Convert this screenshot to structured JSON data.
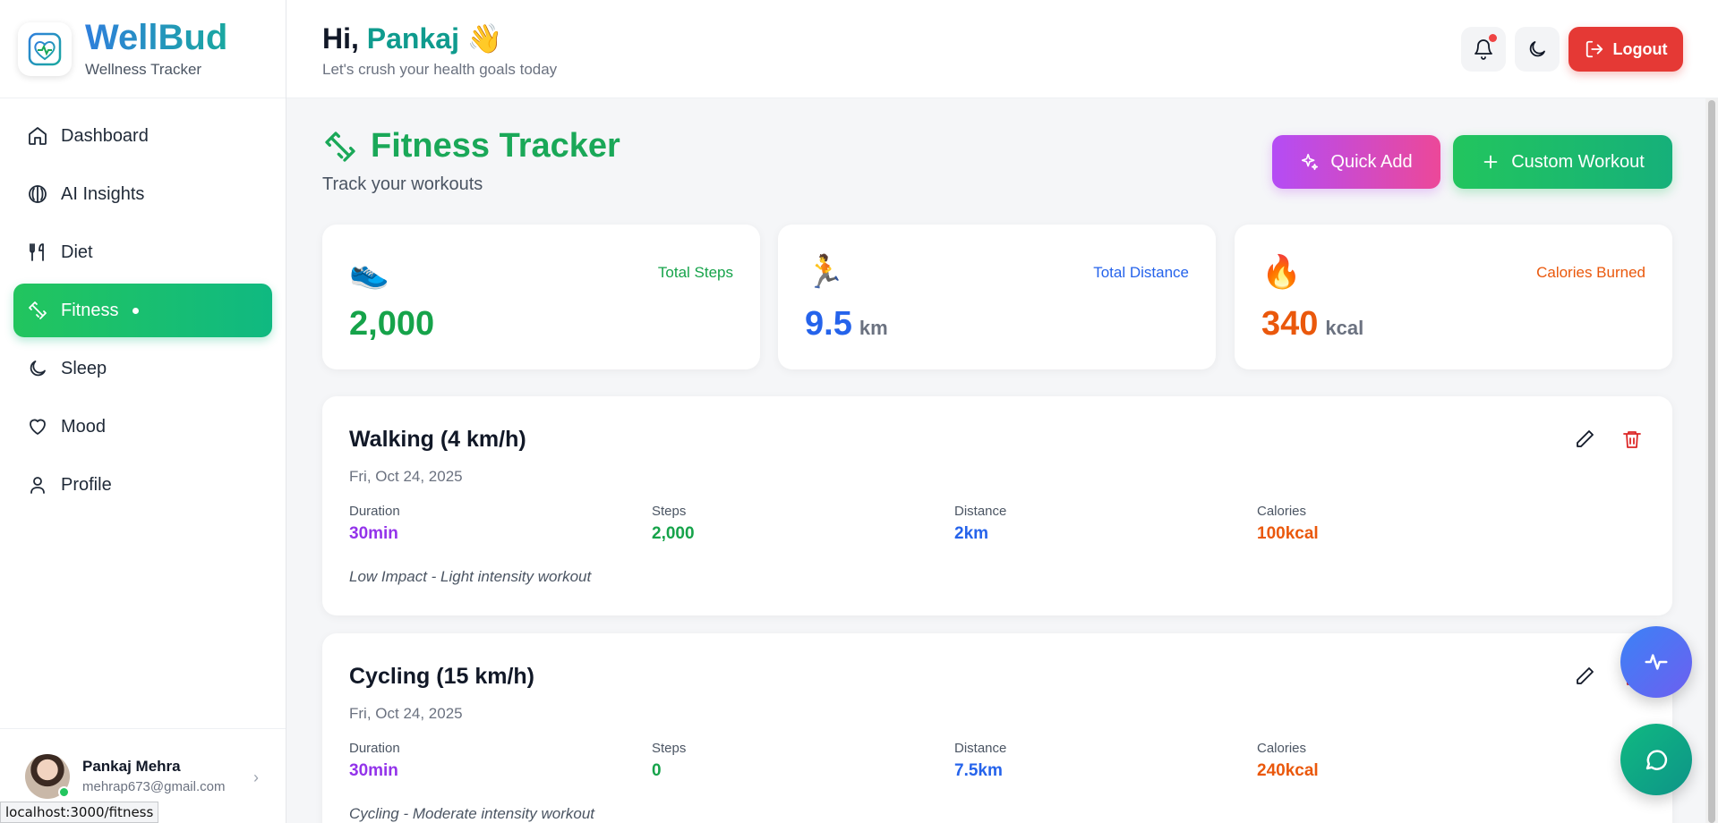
{
  "brand": {
    "name": "WellBud",
    "subtitle": "Wellness Tracker"
  },
  "sidebar": {
    "items": [
      {
        "label": "Dashboard",
        "icon": "home-icon"
      },
      {
        "label": "AI Insights",
        "icon": "brain-icon"
      },
      {
        "label": "Diet",
        "icon": "utensils-icon"
      },
      {
        "label": "Fitness",
        "icon": "dumbbell-icon",
        "active": true
      },
      {
        "label": "Sleep",
        "icon": "moon-icon"
      },
      {
        "label": "Mood",
        "icon": "heart-icon"
      },
      {
        "label": "Profile",
        "icon": "user-icon"
      }
    ]
  },
  "user": {
    "name": "Pankaj Mehra",
    "email": "mehrap673@gmail.com"
  },
  "status_url": "localhost:3000/fitness",
  "header": {
    "greeting_prefix": "Hi,",
    "greeting_name": "Pankaj",
    "greeting_emoji": "👋",
    "subtitle": "Let's crush your health goals today",
    "logout_label": "Logout"
  },
  "page": {
    "title": "Fitness Tracker",
    "subtitle": "Track your workouts",
    "quick_add_label": "Quick Add",
    "custom_workout_label": "Custom Workout"
  },
  "stats": [
    {
      "emoji": "👟",
      "label": "Total Steps",
      "value": "2,000",
      "unit": "",
      "color": "#16a34a"
    },
    {
      "emoji": "🏃",
      "label": "Total Distance",
      "value": "9.5",
      "unit": "km",
      "color": "#2563eb"
    },
    {
      "emoji": "🔥",
      "label": "Calories Burned",
      "value": "340",
      "unit": "kcal",
      "color": "#ea580c"
    }
  ],
  "workout_metric_labels": {
    "duration": "Duration",
    "steps": "Steps",
    "distance": "Distance",
    "calories": "Calories"
  },
  "workouts": [
    {
      "title": "Walking (4 km/h)",
      "date": "Fri, Oct 24, 2025",
      "duration": "30min",
      "steps": "2,000",
      "distance": "2km",
      "calories": "100kcal",
      "note": "Low Impact - Light intensity workout"
    },
    {
      "title": "Cycling (15 km/h)",
      "date": "Fri, Oct 24, 2025",
      "duration": "30min",
      "steps": "0",
      "distance": "7.5km",
      "calories": "240kcal",
      "note": "Cycling - Moderate intensity workout"
    }
  ],
  "colors": {
    "accent_green": "#1aa858",
    "duration": "#9333ea",
    "steps": "#16a34a",
    "distance": "#2563eb",
    "calories": "#ea580c",
    "danger": "#e53935"
  }
}
